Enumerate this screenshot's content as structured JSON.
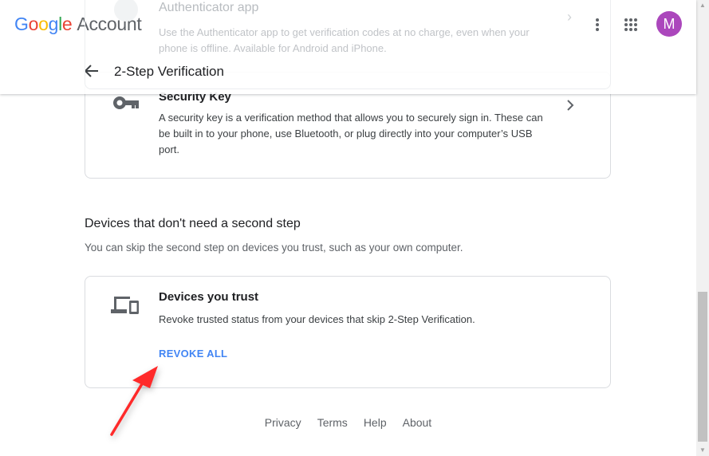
{
  "header": {
    "logo_google": "Google",
    "logo_account": "Account",
    "avatar_letter": "M",
    "avatar_color": "#ab47bc",
    "page_title": "2-Step Verification"
  },
  "behind_card": {
    "title": "Authenticator app",
    "description": "Use the Authenticator app to get verification codes at no charge, even when your phone is offline. Available for Android and iPhone."
  },
  "security_key": {
    "title": "Security Key",
    "description": "A security key is a verification method that allows you to securely sign in. These can be built in to your phone, use Bluetooth, or plug directly into your computer’s USB port.",
    "icon": "key-icon"
  },
  "devices_section": {
    "heading": "Devices that don't need a second step",
    "description": "You can skip the second step on devices you trust, such as your own computer."
  },
  "trusted_devices": {
    "title": "Devices you trust",
    "description": "Revoke trusted status from your devices that skip 2-Step Verification.",
    "action": "REVOKE ALL",
    "icon": "devices-icon",
    "accent": "#4285f4"
  },
  "footer": {
    "links": [
      "Privacy",
      "Terms",
      "Help",
      "About"
    ]
  },
  "annotation_color": "#ff2a2a"
}
